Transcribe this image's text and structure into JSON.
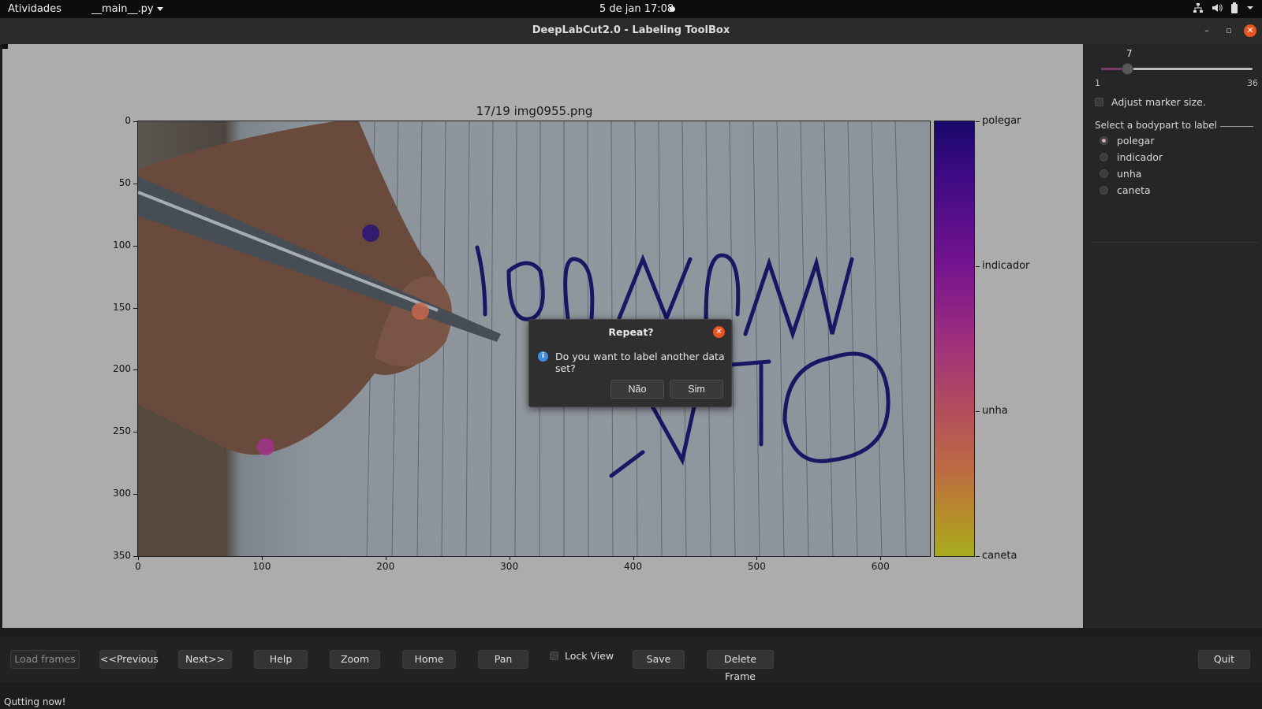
{
  "topbar": {
    "activities": "Atividades",
    "app_menu": "__main__.py",
    "clock": "5 de jan  17:08",
    "tray_icons": [
      "network-icon",
      "volume-icon",
      "battery-icon",
      "chevron-down-icon"
    ]
  },
  "window": {
    "title": "DeepLabCut2.0 - Labeling ToolBox"
  },
  "plot": {
    "title": "17/19 img0955.png",
    "y_ticks": [
      "0",
      "50",
      "100",
      "150",
      "200",
      "250",
      "300",
      "350"
    ],
    "x_ticks": [
      "0",
      "100",
      "200",
      "300",
      "400",
      "500",
      "600"
    ],
    "image_size": [
      640,
      350
    ],
    "colorbar_labels": [
      "polegar",
      "indicador",
      "unha",
      "caneta"
    ],
    "markers": [
      {
        "bodypart": "polegar",
        "x": 188,
        "y": 90,
        "color": "#2b1378"
      },
      {
        "bodypart": "unha",
        "x": 228,
        "y": 153,
        "color": "#c8684e"
      },
      {
        "bodypart": "indicador",
        "x": 103,
        "y": 262,
        "color": "#a1338a"
      }
    ]
  },
  "side_panel": {
    "slider_value": "7",
    "slider_min": "1",
    "slider_max": "36",
    "slider_fraction": 0.17,
    "adjust_marker_label": "Adjust marker size.",
    "group_title": "Select a bodypart to label",
    "bodyparts": [
      {
        "label": "polegar",
        "checked": true
      },
      {
        "label": "indicador",
        "checked": false
      },
      {
        "label": "unha",
        "checked": false
      },
      {
        "label": "caneta",
        "checked": false
      }
    ]
  },
  "toolbar": {
    "load_frames": "Load frames",
    "previous": "<<Previous",
    "next": "Next>>",
    "help": "Help",
    "zoom": "Zoom",
    "home": "Home",
    "pan": "Pan",
    "lock_view": "Lock View",
    "save": "Save",
    "delete_frame": "Delete Frame",
    "quit": "Quit"
  },
  "status": "Qutting now!",
  "dialog": {
    "title": "Repeat?",
    "message": "Do you want to label another data set?",
    "no": "Não",
    "yes": "Sim"
  }
}
